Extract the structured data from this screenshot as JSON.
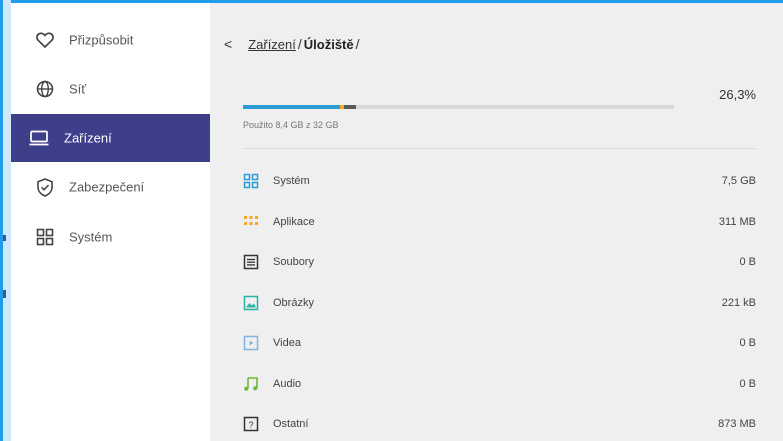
{
  "sidebar": {
    "items": [
      {
        "label": "Přizpůsobit",
        "icon": "heart-icon"
      },
      {
        "label": "Síť",
        "icon": "globe-icon"
      },
      {
        "label": "Zařízení",
        "icon": "monitor-icon",
        "active": true
      },
      {
        "label": "Zabezpečení",
        "icon": "shield-check-icon"
      },
      {
        "label": "Systém",
        "icon": "grid-icon"
      }
    ]
  },
  "breadcrumb": {
    "back": "<",
    "parent": "Zařízení",
    "separator": "/",
    "current": "Úložiště",
    "trailing": "/"
  },
  "storage": {
    "percent_text": "26,3%",
    "percent": 26.3,
    "used_text": "Použito 8,4 GB z 32 GB",
    "colors": {
      "system": "#2a9bd6",
      "apps": "#f5a623",
      "other": "#5a5a5a",
      "track": "#d9d9d9"
    },
    "rows": [
      {
        "label": "Systém",
        "value": "7,5 GB",
        "icon": "system-grid-icon",
        "color": "#2a9bd6"
      },
      {
        "label": "Aplikace",
        "value": "311 MB",
        "icon": "apps-dots-icon",
        "color": "#f5a623"
      },
      {
        "label": "Soubory",
        "value": "0 B",
        "icon": "files-icon",
        "color": "#3a3a3a"
      },
      {
        "label": "Obrázky",
        "value": "221 kB",
        "icon": "image-icon",
        "color": "#26b5a3"
      },
      {
        "label": "Videa",
        "value": "0 B",
        "icon": "video-icon",
        "color": "#7fb6e6"
      },
      {
        "label": "Audio",
        "value": "0 B",
        "icon": "music-note-icon",
        "color": "#6bb83a"
      },
      {
        "label": "Ostatní",
        "value": "873 MB",
        "icon": "question-box-icon",
        "color": "#3a3a3a"
      }
    ]
  }
}
